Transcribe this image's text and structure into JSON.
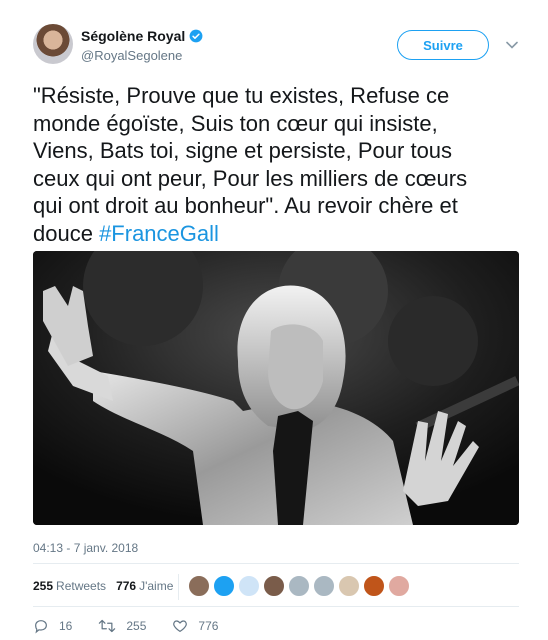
{
  "user": {
    "display_name": "Ségolène Royal",
    "handle": "@RoyalSegolene",
    "verified": true
  },
  "header": {
    "follow_label": "Suivre",
    "menu_icon": "chevron-down-icon"
  },
  "tweet": {
    "text": "\"Résiste, Prouve que tu existes, Refuse ce\nmonde égoïste, Suis ton cœur qui insiste,\nViens, Bats toi, signe et persiste, Pour tous\nceux qui ont peur, Pour les milliers de cœurs\nqui ont droit au bonheur\". Au revoir chère et\ndouce ",
    "hashtag": "#FranceGall",
    "timestamp": "04:13 - 7 janv. 2018"
  },
  "stats": {
    "retweets_count": "255",
    "retweets_label": "Retweets",
    "likes_count": "776",
    "likes_label": "J'aime",
    "liker_colors": [
      "#8a6d5a",
      "#1da1f2",
      "#cfe4f7",
      "#7a5c4a",
      "#aab8c2",
      "#aab8c2",
      "#d9c7b0",
      "#c0551a",
      "#e0a9a0"
    ]
  },
  "actions": {
    "reply_count": "16",
    "retweet_count": "255",
    "like_count": "776"
  },
  "colors": {
    "accent": "#1da1f2",
    "hashtag": "#1b95e0",
    "muted": "#657786"
  }
}
